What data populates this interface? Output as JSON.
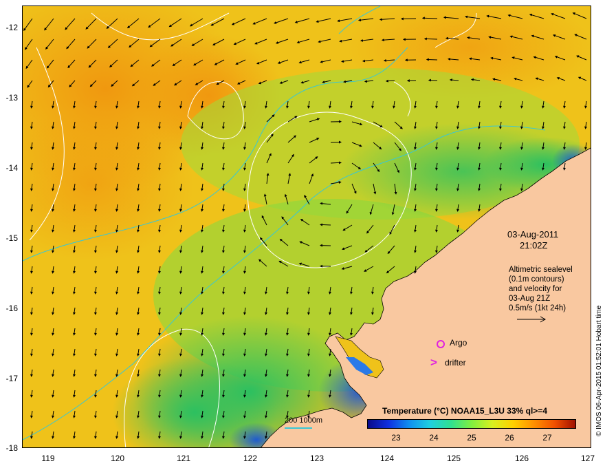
{
  "map": {
    "date": "03-Aug-2011",
    "time": "21:02Z",
    "info_lines": [
      "Altimetric sealevel",
      "(0.1m contours)",
      "and velocity for",
      "03-Aug 21Z",
      "0.5m/s (1kt 24h)"
    ],
    "legend": {
      "argo": "Argo",
      "drifter": "drifter",
      "depth_contours": "200  1000m"
    },
    "colorbar": {
      "title": "Temperature (°C) NOAA15_L3U 33% ql>=4",
      "ticks": [
        "23",
        "24",
        "25",
        "26",
        "27"
      ]
    },
    "credit": "© IMOS 06-Apr-2015 01:52:01 Hobart time",
    "axes": {
      "y_ticks": [
        "-12",
        "-13",
        "-14",
        "-15",
        "-16",
        "-17",
        "-18"
      ],
      "x_ticks": [
        "119",
        "120",
        "121",
        "122",
        "123",
        "124",
        "125",
        "126",
        "127"
      ]
    },
    "colors": {
      "land": "#f9c8a0",
      "contour": "#ffffff",
      "isobath": "#37c7d6",
      "marker": "#e020e0",
      "warm": "#f0a018",
      "mid": "#f2c818",
      "cool": "#30c040"
    }
  }
}
